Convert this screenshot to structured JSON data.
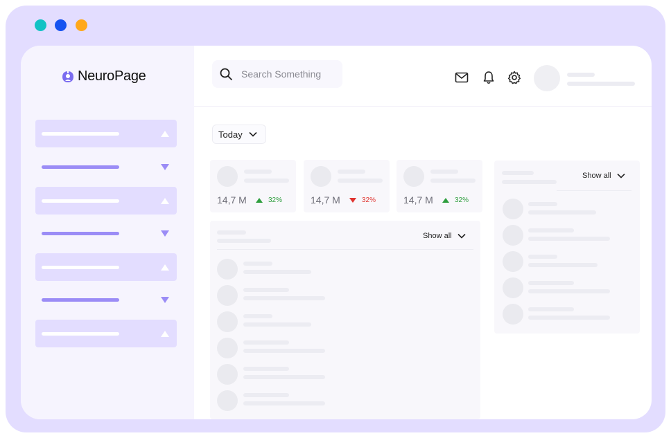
{
  "window_controls": {
    "close_color": "#12c2c5",
    "minimize_color": "#1552f0",
    "maximize_color": "#ffa81a"
  },
  "brand": {
    "name": "NeuroPage",
    "accent": "#7b6cf0"
  },
  "sidebar": {
    "items": [
      {
        "state": "active",
        "caret": "up"
      },
      {
        "state": "inactive",
        "caret": "down"
      },
      {
        "state": "active",
        "caret": "up"
      },
      {
        "state": "inactive",
        "caret": "down"
      },
      {
        "state": "active",
        "caret": "up"
      },
      {
        "state": "inactive",
        "caret": "down"
      },
      {
        "state": "active",
        "caret": "up"
      }
    ]
  },
  "header": {
    "search_placeholder": "Search Something",
    "icons": [
      "mail-icon",
      "bell-icon",
      "gear-icon",
      "avatar"
    ]
  },
  "filter": {
    "label": "Today"
  },
  "stats": [
    {
      "value": "14,7 M",
      "change": "32%",
      "trend": "up"
    },
    {
      "value": "14,7 M",
      "change": "32%",
      "trend": "down"
    },
    {
      "value": "14,7 M",
      "change": "32%",
      "trend": "up"
    }
  ],
  "main_panel": {
    "show_all_label": "Show all"
  },
  "side_panel": {
    "show_all_label": "Show all"
  },
  "colors": {
    "up": "#2e9e3e",
    "down": "#e0332f",
    "active_bg": "#e3ddff"
  }
}
